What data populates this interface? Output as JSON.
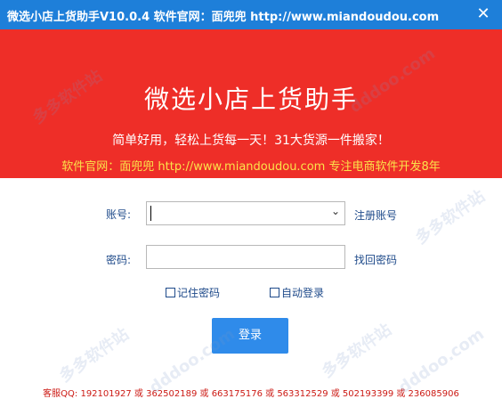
{
  "titlebar": {
    "title": "微选小店上货助手V10.0.4  软件官网：面兜兜 http://www.miandoudou.com",
    "close_icon": "close-icon"
  },
  "banner": {
    "headline": "微选小店上货助手",
    "slogan": "简单好用，轻松上货每一天！31大货源一件搬家！",
    "site": "软件官网：面兜兜 http://www.miandoudou.com 专注电商软件开发8年"
  },
  "form": {
    "account_label": "账号:",
    "account_value": "",
    "register_link": "注册账号",
    "password_label": "密码:",
    "password_value": "",
    "recover_link": "找回密码",
    "remember_password": "记住密码",
    "auto_login": "自动登录",
    "login_button": "登录"
  },
  "footer": {
    "support": "客服QQ: 192101927 或 362502189 或 663175176 或 563312529 或 502193399 或 236085906"
  },
  "watermark": {
    "text1": "多多软件站",
    "text2": "dddoo.com"
  },
  "colors": {
    "titlebar": "#1e7fd9",
    "banner": "#ee2e28",
    "site_text": "#fbe24a",
    "login_button": "#2f8bea",
    "footer_text": "#cc1a14"
  }
}
